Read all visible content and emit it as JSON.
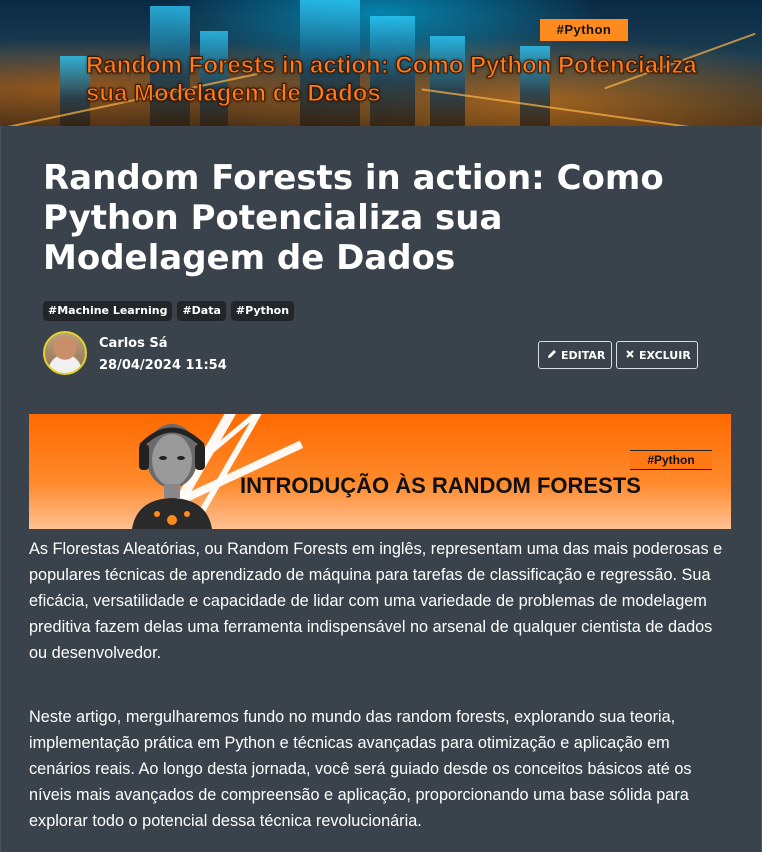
{
  "hero": {
    "tag": "#Python",
    "title": "Random Forests in action: Como Python Potencializa sua Modelagem de Dados"
  },
  "article": {
    "title": "Random Forests in action: Como Python Potencializa sua Modelagem de Dados",
    "tags": [
      "#Machine Learning",
      "#Data",
      "#Python"
    ],
    "author": {
      "name": "Carlos Sá",
      "date": "28/04/2024 11:54"
    },
    "actions": {
      "edit_label": "EDITAR",
      "delete_label": "EXCLUIR"
    }
  },
  "section_banner": {
    "tag": "#Python",
    "title": "INTRODUÇÃO ÀS RANDOM FORESTS"
  },
  "body": {
    "paragraph_1": "As Florestas Aleatórias, ou Random Forests em inglês, representam uma das mais poderosas e populares técnicas de aprendizado de máquina para tarefas de classificação e regressão. Sua eficácia, versatilidade e capacidade de lidar com uma variedade de problemas de modelagem preditiva fazem delas uma ferramenta indispensável no arsenal de qualquer cientista de dados ou desenvolvedor.",
    "paragraph_2": "Neste artigo, mergulharemos fundo no mundo das random forests, explorando sua teoria, implementação prática em Python e técnicas avançadas para otimização e aplicação em cenários reais. Ao longo desta jornada, você será guiado desde os conceitos básicos até os níveis mais avançados de compreensão e aplicação, proporcionando uma base sólida para explorar todo o potencial dessa técnica revolucionária."
  },
  "icons": {
    "edit": "pencil-icon",
    "delete": "close-icon"
  },
  "colors": {
    "accent": "#ff7a1a",
    "background": "#3a424b",
    "tag_bg": "#232629",
    "avatar_ring": "#e3d02b"
  }
}
